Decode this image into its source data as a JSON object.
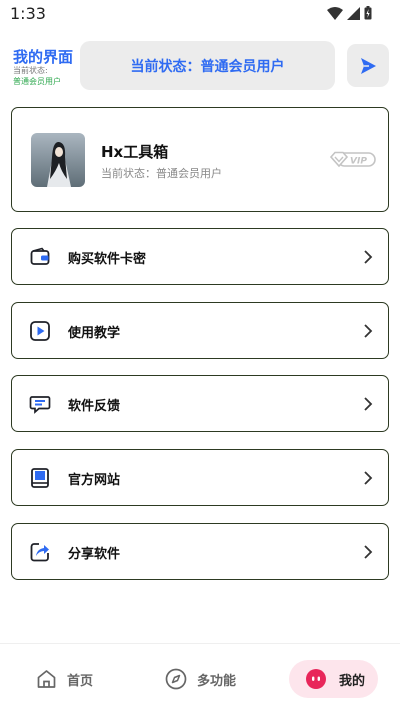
{
  "status_bar": {
    "time": "1:33"
  },
  "header": {
    "title": "我的界面",
    "sub_line1": "当前状态:",
    "sub_line2": "普通会员用户",
    "status_pill": "当前状态：普通会员用户"
  },
  "profile": {
    "name": "Hx工具箱",
    "status": "当前状态：普通会员用户",
    "badge": "VIP"
  },
  "menu": [
    {
      "label": "购买软件卡密",
      "icon": "wallet-icon"
    },
    {
      "label": "使用教学",
      "icon": "play-icon"
    },
    {
      "label": "软件反馈",
      "icon": "feedback-icon"
    },
    {
      "label": "官方网站",
      "icon": "book-icon"
    },
    {
      "label": "分享软件",
      "icon": "share-icon"
    }
  ],
  "bottom_nav": {
    "home": "首页",
    "features": "多功能",
    "mine": "我的",
    "active": "mine"
  },
  "colors": {
    "accent": "#2f6bf2",
    "green_text": "#2fa84f",
    "card_border": "#2d3a22",
    "active_tab_bg": "#fde5ec",
    "active_tab_icon": "#e8265a"
  }
}
